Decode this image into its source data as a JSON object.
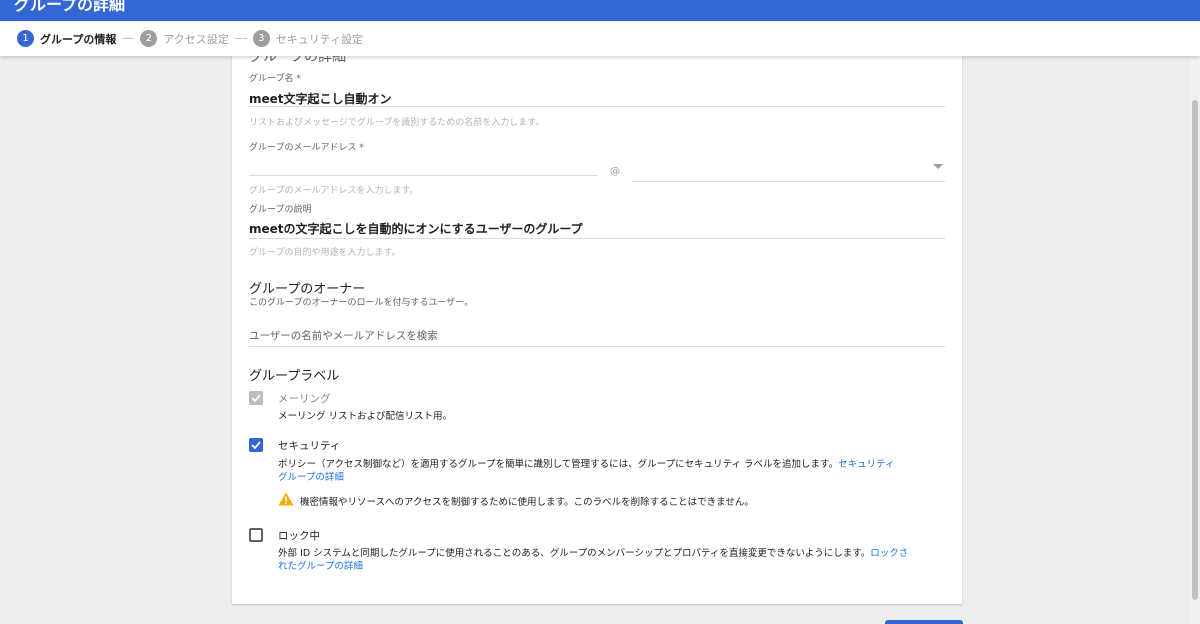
{
  "header": {
    "title": "グループの詳細"
  },
  "stepper": {
    "steps": [
      {
        "num": "1",
        "label": "グループの情報"
      },
      {
        "num": "2",
        "label": "アクセス設定"
      },
      {
        "num": "3",
        "label": "セキュリティ設定"
      }
    ]
  },
  "form": {
    "section_heading": "グループの詳細",
    "name": {
      "label": "グループ名 *",
      "value": "meet文字起こし自動オン",
      "hint": "リストおよびメッセージでグループを識別するための名前を入力します。"
    },
    "email": {
      "label": "グループのメールアドレス *",
      "value": "",
      "at": "@",
      "domain": "",
      "hint": "グループのメールアドレスを入力します。"
    },
    "description": {
      "label": "グループの説明",
      "value": "meetの文字起こしを自動的にオンにするユーザーのグループ",
      "hint": "グループの目的や用途を入力します。"
    }
  },
  "owners": {
    "title": "グループのオーナー",
    "subtitle": "このグループのオーナーのロールを付与するユーザー。",
    "search_placeholder": "ユーザーの名前やメールアドレスを検索"
  },
  "labels": {
    "title": "グループラベル",
    "mailing": {
      "title": "メーリング",
      "desc": "メーリング リストおよび配信リスト用。",
      "checked": true,
      "disabled": true
    },
    "security": {
      "title": "セキュリティ",
      "desc_text": "ポリシー（アクセス制御など）を適用するグループを簡単に識別して管理するには、グループにセキュリティ ラベルを追加します。",
      "desc_link_1": "セキュリティ",
      "desc_link_2": "グループの詳細",
      "warning": "機密情報やリソースへのアクセスを制御するために使用します。このラベルを削除することはできません。",
      "checked": true
    },
    "locked": {
      "title": "ロック中",
      "desc_text": "外部 ID システムと同期したグループに使用されることのある、グループのメンバーシップとプロパティを直接変更できないようにします。",
      "desc_link_1": "ロックさ",
      "desc_link_2": "れたグループの詳細",
      "checked": false
    }
  },
  "colors": {
    "accent": "#3367d6",
    "link": "#1a73e8",
    "warning": "#f9ab00"
  }
}
